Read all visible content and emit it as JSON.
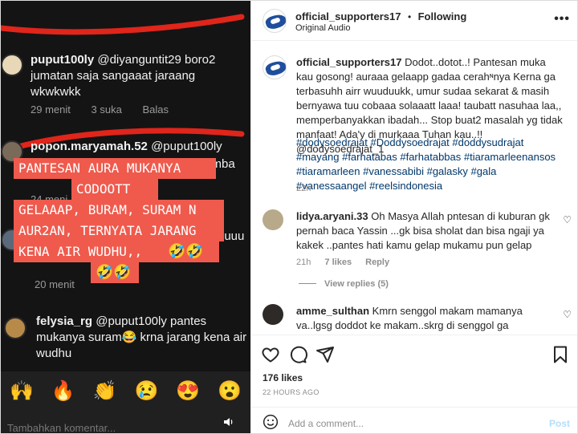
{
  "media": {
    "comments": [
      {
        "user": "puput100ly",
        "mention": "@diyanguntit29",
        "text": "boro2 jumatan saja sangaaat jaraang wkwkwkk",
        "time": "29 menit",
        "likes": "3 suka",
        "reply": "Balas"
      },
      {
        "user": "popon.maryamah.52",
        "mention": "@puput100ly",
        "text": "...mba",
        "time": "24 meni"
      },
      {
        "user": "",
        "mention": "",
        "text": "nuuu",
        "time": "20 menit"
      },
      {
        "user": "felysia_rg",
        "mention": "@puput100ly",
        "text": "pantes mukanya suram😂 krna jarang kena air wudhu"
      }
    ],
    "overlay_lines": [
      "PANTESAN AURA MUKANYA",
      "CODOOTT",
      "GELAAAP, BURAM, SURAM N",
      "AUR2AN, TERNYATA JARANG",
      "KENA AIR WUDHU,,",
      "🤣🤣"
    ],
    "overlay_emoji_inline": "🤣🤣",
    "emoji_bar": [
      "🙌",
      "🔥",
      "👏",
      "😢",
      "😍",
      "😮"
    ],
    "footer_placeholder": "Tambahkan komentar...",
    "sound_icon": "speaker-icon"
  },
  "post": {
    "username": "official_supporters17",
    "follow_label": "Following",
    "separator": "•",
    "audio": "Original Audio",
    "caption_user": "official_supporters17",
    "caption_text": "Dodot..dotot..! Pantesan muka kau gosong! auraaa gelaapp gadaa cerahᶰnya Kerna ga terbasuhh airr wuuduukk, umur sudaa sekarat & masih bernyawa tuu cobaaa solaaatt laaa! taubatt nasuhaa laa,, memperbanyakkan ibadah... Stop buat2 masalah yg tidak manfaat! Ada'y di murkaaa Tuhan kau..!! @dodysoedrajat_1",
    "hashtags": "#dodysoedrajat #Doddysoedrajat #doddysudrajat #mayang #farhatabas #farhatabbas #tiaramarleenansos #tiaramarleen #vanessabibi #galasky #gala #vanessaangel #reelsindonesia",
    "caption_time": "22h",
    "comments": [
      {
        "user": "lidya.aryani.33",
        "text": "Oh Masya Allah pntesan di kuburan gk pernah baca Yassin ...gk bisa sholat dan bisa ngaji ya kakek ..pantes hati kamu gelap mukamu pun gelap",
        "time": "21h",
        "likes": "7 likes",
        "reply": "Reply",
        "view_replies": "View replies (5)"
      },
      {
        "user": "amme_sulthan",
        "text": "Kmrn senggol makam mamanya va..lgsg doddot ke makam..skrg di senggol ga sholat..ntar ada vido ato foto viral kabur 🙏🙏"
      }
    ],
    "likes": "176 likes",
    "posted": "22 HOURS AGO",
    "add_comment_placeholder": "Add a comment...",
    "post_label": "Post"
  },
  "colors": {
    "overlay": "#ef5a4d",
    "link": "#00376b",
    "post_btn": "#b2dffc",
    "brand": "#1f4f9c"
  }
}
